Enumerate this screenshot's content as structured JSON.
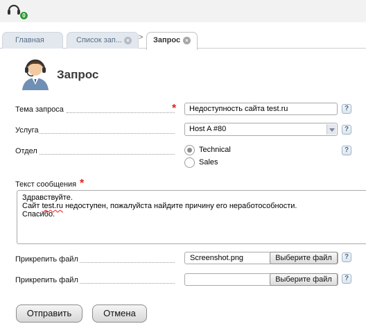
{
  "topbar": {
    "notification_count": "0"
  },
  "tabs": [
    {
      "label": "Главная"
    },
    {
      "label": "Список зап..."
    },
    {
      "label": "Запрос"
    }
  ],
  "breadcrumb_sep": ">",
  "page": {
    "title": "Запрос"
  },
  "form": {
    "subject": {
      "label": "Тема запроса",
      "value": "Недоступность сайта test.ru",
      "required": "*"
    },
    "service": {
      "label": "Услуга",
      "value": "Host A #80"
    },
    "department": {
      "label": "Отдел",
      "options": [
        "Technical",
        "Sales"
      ],
      "selected": "Technical"
    },
    "message": {
      "label": "Текст сообщения",
      "required": "*",
      "lines": [
        "Здравствуйте.",
        "Сайт ",
        "test.ru",
        " недоступен, пожалуйста найдите причину его неработособности.",
        "Спасибо."
      ]
    },
    "attach1": {
      "label": "Прикрепить файл",
      "filename": "Screenshot.png",
      "button": "Выберите файл"
    },
    "attach2": {
      "label": "Прикрепить файл",
      "filename": "",
      "button": "Выберите файл"
    },
    "help": "?"
  },
  "actions": {
    "submit": "Отправить",
    "cancel": "Отмена"
  }
}
